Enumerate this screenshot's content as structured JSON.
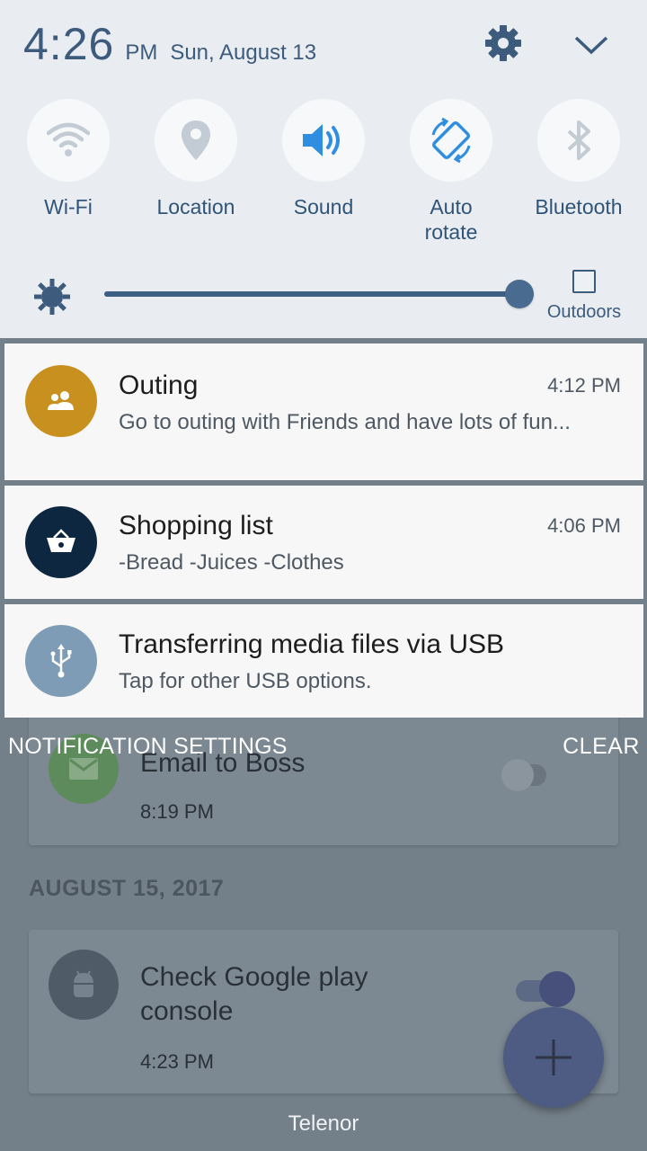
{
  "status": {
    "time": "4:26",
    "ampm": "PM",
    "date": "Sun, August 13"
  },
  "quick_tiles": [
    {
      "label": "Wi-Fi",
      "icon": "wifi-icon"
    },
    {
      "label": "Location",
      "icon": "location-icon"
    },
    {
      "label": "Sound",
      "icon": "sound-icon"
    },
    {
      "label": "Auto\nrotate",
      "icon": "auto-rotate-icon"
    },
    {
      "label": "Bluetooth",
      "icon": "bluetooth-icon"
    }
  ],
  "brightness": {
    "level": 0.97,
    "outdoors_label": "Outdoors"
  },
  "notifications": [
    {
      "title": "Outing",
      "text": "Go to outing with Friends and have lots of fun...",
      "time": "4:12 PM",
      "icon": "group-icon",
      "color": "#c8901e"
    },
    {
      "title": "Shopping list",
      "text": "-Bread -Juices  -Clothes",
      "time": "4:06 PM",
      "icon": "basket-icon",
      "color": "#0e2740"
    },
    {
      "title": "Transferring media files via USB",
      "text": "Tap for other USB options.",
      "time": "",
      "icon": "usb-icon",
      "color": "#7f9cb6"
    }
  ],
  "footer": {
    "settings_label": "NOTIFICATION SETTINGS",
    "clear_label": "CLEAR"
  },
  "background_app": {
    "card1": {
      "title": "Email to Boss",
      "time": "8:19 PM"
    },
    "section_date": "AUGUST 15, 2017",
    "card2": {
      "title": "Check Google play console",
      "time": "4:23 PM"
    }
  },
  "carrier": "Telenor",
  "colors": {
    "accent": "#3d5b7d",
    "panel": "#e9edf1",
    "tile_blue": "#2f8ee0"
  }
}
